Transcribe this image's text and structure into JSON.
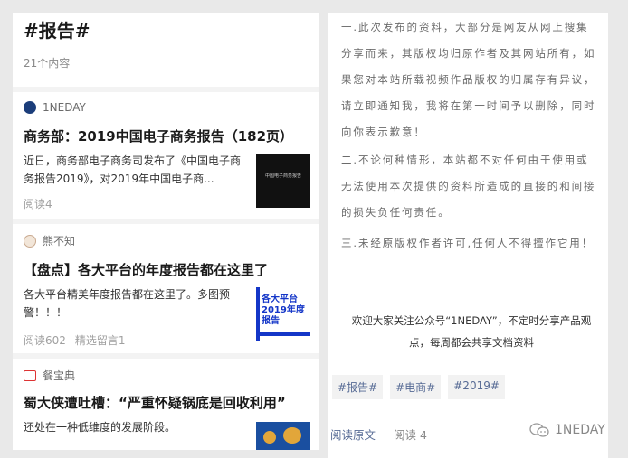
{
  "left": {
    "header": {
      "title": "#报告#",
      "count": "21个内容"
    },
    "articles": [
      {
        "source": "1NEDAY",
        "title": "商务部：2019中国电子商务报告（182页）",
        "desc": "近日，商务部电子商务司发布了《中国电子商务报告2019》，对2019年中国电子商...",
        "reads": "阅读4",
        "extra": "",
        "thumb_text": "中国电子商务报告"
      },
      {
        "source": "熊不知",
        "title": "【盘点】各大平台的年度报告都在这里了",
        "desc": "各大平台精美年度报告都在这里了。多图预警！！！",
        "reads": "阅读602",
        "extra": "精选留言1",
        "thumb_text": "各大平台 2019年度报告"
      },
      {
        "source": "餐宝典",
        "title": "蜀大侠遭吐槽：“严重怀疑锅底是回收利用”",
        "desc": "还处在一种低维度的发展阶段。",
        "reads": "",
        "extra": "",
        "thumb_text": ""
      }
    ]
  },
  "right": {
    "paragraphs": [
      "一.此次发布的资料，大部分是网友从网上搜集分享而来，其版权均归原作者及其网站所有，如果您对本站所载视频作品版权的归属存有异议，请立即通知我，我将在第一时间予以删除，同时向你表示歉意！",
      "二.不论何种情形，本站都不对任何由于使用或无法使用本次提供的资料所造成的直接的和间接的损失负任何责任。",
      "三.未经原版权作者许可,任何人不得擅作它用！"
    ],
    "welcome": "欢迎大家关注公众号“1NEDAY”，不定时分享产品观点，每周都会共享文档资料",
    "tags": [
      "#报告#",
      "#电商#",
      "#2019#"
    ],
    "read_original": "阅读原文",
    "read_count": "阅读 4",
    "watermark": "1NEDAY"
  },
  "colors": {
    "link": "#576b95",
    "tag_bg": "#f2f2f2",
    "thumb2_blue": "#1436c8"
  }
}
